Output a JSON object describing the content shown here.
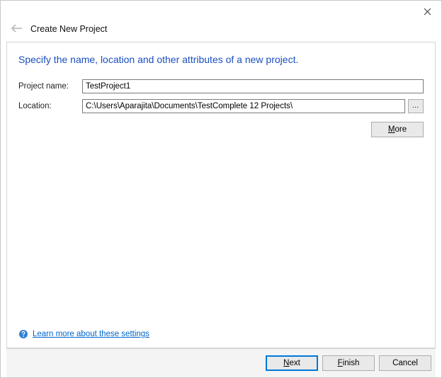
{
  "window": {
    "title": "Create New Project"
  },
  "instruction": "Specify the name, location and other attributes of a new project.",
  "form": {
    "projectName": {
      "label": "Project name:",
      "value": "TestProject1"
    },
    "location": {
      "label": "Location:",
      "value": "C:\\Users\\Aparajita\\Documents\\TestComplete 12 Projects\\",
      "browse": "…"
    },
    "moreBtn": "More"
  },
  "help": {
    "linkText": "Learn more about these settings"
  },
  "buttons": {
    "next": "Next",
    "finish": "Finish",
    "cancel": "Cancel"
  }
}
